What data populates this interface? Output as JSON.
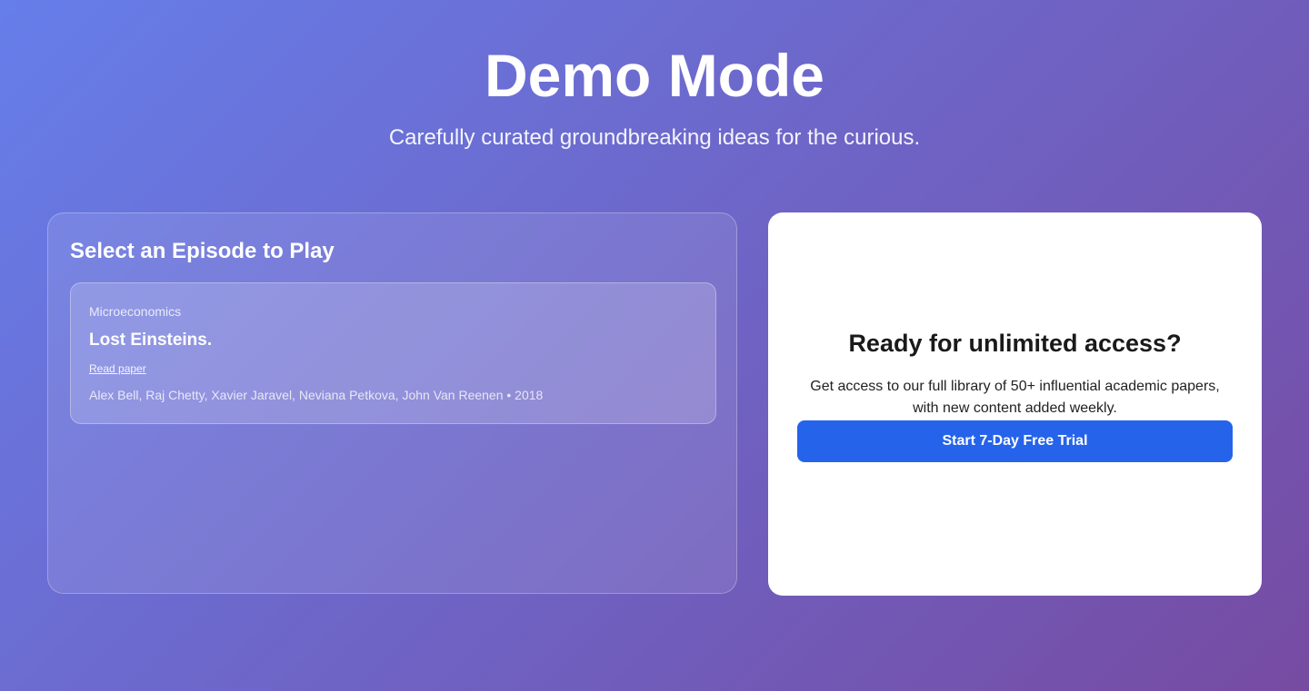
{
  "hero": {
    "title": "Demo Mode",
    "subtitle": "Carefully curated groundbreaking ideas for the curious."
  },
  "episodes": {
    "heading": "Select an Episode to Play",
    "items": [
      {
        "category": "Microeconomics",
        "title": "Lost Einsteins.",
        "link_label": "Read paper",
        "meta": "Alex Bell, Raj Chetty, Xavier Jaravel, Neviana Petkova, John Van Reenen • 2018"
      }
    ]
  },
  "cta": {
    "title": "Ready for unlimited access?",
    "text": "Get access to our full library of 50+ influential academic papers, with new content added weekly.",
    "button_label": "Start 7-Day Free Trial",
    "accent_color": "#2563eb"
  },
  "colors": {
    "background_start": "#667eea",
    "background_end": "#764ba2"
  }
}
